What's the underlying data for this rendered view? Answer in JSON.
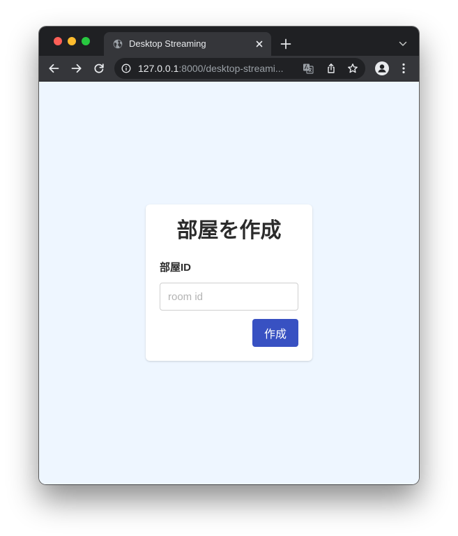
{
  "browser": {
    "tab": {
      "title": "Desktop Streaming"
    },
    "address": {
      "host": "127.0.0.1",
      "rest": ":8000/desktop-streami..."
    }
  },
  "page": {
    "title": "部屋を作成",
    "room_label": "部屋ID",
    "room_input": {
      "placeholder": "room id",
      "value": ""
    },
    "create_button": "作成"
  },
  "colors": {
    "page_background": "#eef6ff",
    "button_primary": "#3851c2",
    "titlebar": "#1f2023",
    "toolbar": "#35363a"
  },
  "icons": {
    "tab_favicon": "globe-icon",
    "tab_close": "close-icon",
    "new_tab": "plus-icon",
    "tab_search": "chevron-down-icon",
    "back": "arrow-left-icon",
    "forward": "arrow-right-icon",
    "reload": "reload-icon",
    "site_info": "info-icon",
    "translate": "translate-icon",
    "share": "share-icon",
    "bookmark": "star-icon",
    "profile": "profile-icon",
    "menu": "kebab-menu-icon"
  }
}
